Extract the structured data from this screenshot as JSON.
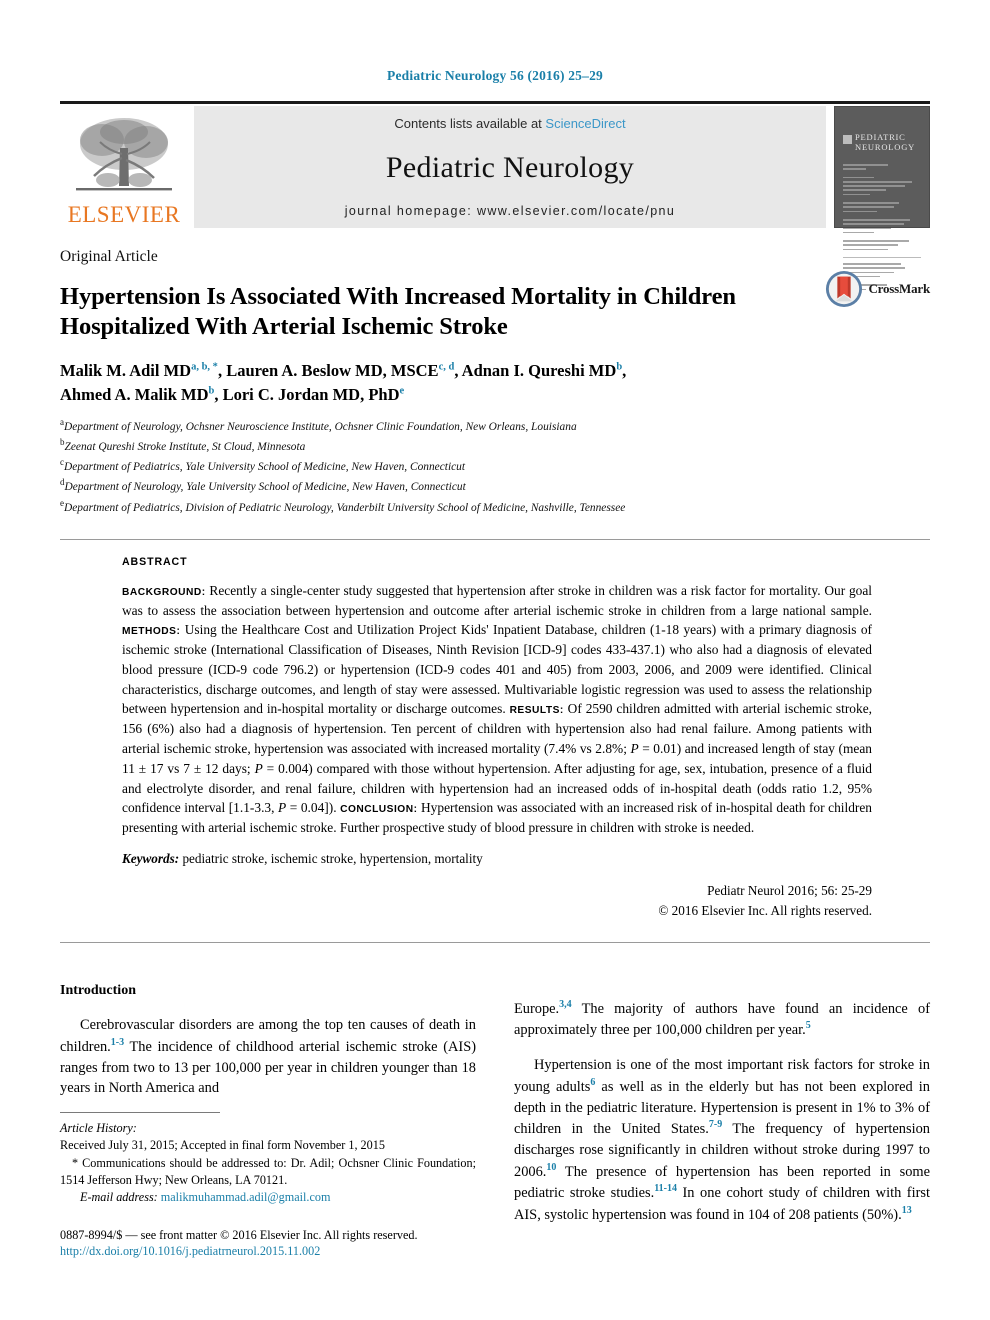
{
  "running_head": "Pediatric Neurology 56 (2016) 25–29",
  "banner": {
    "contents_prefix": "Contents lists available at ",
    "sciencedirect": "ScienceDirect",
    "journal_name": "Pediatric Neurology",
    "homepage": "journal homepage: www.elsevier.com/locate/pnu",
    "publisher": "ELSEVIER",
    "cover_title_line1": "PEDIATRIC",
    "cover_title_line2": "NEUROLOGY"
  },
  "article": {
    "kicker": "Original Article",
    "title_line1": "Hypertension Is Associated With Increased Mortality in Children",
    "title_line2": "Hospitalized With Arterial Ischemic Stroke",
    "crossmark_label": "CrossMark",
    "authors_line1": "Malik M. Adil MD",
    "authors_line1_sup": "a, b, *",
    "authors_line1b": ", Lauren A. Beslow MD, MSCE",
    "authors_line1b_sup": "c, d",
    "authors_line1c": ", Adnan I. Qureshi MD",
    "authors_line1c_sup": "b",
    "authors_line1d": ",",
    "authors_line2": "Ahmed A. Malik MD",
    "authors_line2_sup": "b",
    "authors_line2b": ", Lori C. Jordan MD, PhD",
    "authors_line2b_sup": "e",
    "affiliations": [
      {
        "mark": "a",
        "text": "Department of Neurology, Ochsner Neuroscience Institute, Ochsner Clinic Foundation, New Orleans, Louisiana"
      },
      {
        "mark": "b",
        "text": "Zeenat Qureshi Stroke Institute, St Cloud, Minnesota"
      },
      {
        "mark": "c",
        "text": "Department of Pediatrics, Yale University School of Medicine, New Haven, Connecticut"
      },
      {
        "mark": "d",
        "text": "Department of Neurology, Yale University School of Medicine, New Haven, Connecticut"
      },
      {
        "mark": "e",
        "text": "Department of Pediatrics, Division of Pediatric Neurology, Vanderbilt University School of Medicine, Nashville, Tennessee"
      }
    ]
  },
  "abstract": {
    "label": "ABSTRACT",
    "background_label": "BACKGROUND:",
    "background_text": " Recently a single-center study suggested that hypertension after stroke in children was a risk factor for mortality. Our goal was to assess the association between hypertension and outcome after arterial ischemic stroke in children from a large national sample. ",
    "methods_label": "METHODS:",
    "methods_text": " Using the Healthcare Cost and Utilization Project Kids' Inpatient Database, children (1-18 years) with a primary diagnosis of ischemic stroke (International Classification of Diseases, Ninth Revision [ICD-9] codes 433-437.1) who also had a diagnosis of elevated blood pressure (ICD-9 code 796.2) or hypertension (ICD-9 codes 401 and 405) from 2003, 2006, and 2009 were identified. Clinical characteristics, discharge outcomes, and length of stay were assessed. Multivariable logistic regression was used to assess the relationship between hypertension and in-hospital mortality or discharge outcomes. ",
    "results_label": "RESULTS:",
    "results_text_a": " Of 2590 children admitted with arterial ischemic stroke, 156 (6%) also had a diagnosis of hypertension. Ten percent of children with hypertension also had renal failure. Among patients with arterial ischemic stroke, hypertension was associated with increased mortality (7.4% vs 2.8%; ",
    "results_p1": "P",
    "results_text_b": " = 0.01) and increased length of stay (mean 11 ± 17 vs 7 ± 12 days; ",
    "results_p2": "P",
    "results_text_c": " = 0.004) compared with those without hypertension. After adjusting for age, sex, intubation, presence of a fluid and electrolyte disorder, and renal failure, children with hypertension had an increased odds of in-hospital death (odds ratio 1.2, 95% confidence interval [1.1-3.3, ",
    "results_p3": "P",
    "results_text_d": " = 0.04]). ",
    "conclusion_label": "CONCLUSION:",
    "conclusion_text": " Hypertension was associated with an increased risk of in-hospital death for children presenting with arterial ischemic stroke. Further prospective study of blood pressure in children with stroke is needed.",
    "keywords_label": "Keywords:",
    "keywords_text": " pediatric stroke, ischemic stroke, hypertension, mortality",
    "citation": "Pediatr Neurol 2016; 56: 25-29",
    "copyright": "© 2016 Elsevier Inc. All rights reserved."
  },
  "body": {
    "intro_heading": "Introduction",
    "left_para1_a": "Cerebrovascular disorders are among the top ten causes of death in children.",
    "left_para1_ref1": "1-3",
    "left_para1_b": " The incidence of childhood arterial ischemic stroke (AIS) ranges from two to 13 per 100,000 per year in children younger than 18 years in North America and",
    "right_para1_a": "Europe.",
    "right_para1_ref1": "3,4",
    "right_para1_b": " The majority of authors have found an incidence of approximately three per 100,000 children per year.",
    "right_para1_ref2": "5",
    "right_para2_a": "Hypertension is one of the most important risk factors for stroke in young adults",
    "right_para2_ref1": "6",
    "right_para2_b": " as well as in the elderly but has not been explored in depth in the pediatric literature. Hypertension is present in 1% to 3% of children in the United States.",
    "right_para2_ref2": "7-9",
    "right_para2_c": " The frequency of hypertension discharges rose significantly in children without stroke during 1997 to 2006.",
    "right_para2_ref3": "10",
    "right_para2_d": " The presence of hypertension has been reported in some pediatric stroke studies.",
    "right_para2_ref4": "11-14",
    "right_para2_e": " In one cohort study of children with first AIS, systolic hypertension was found in 104 of 208 patients (50%).",
    "right_para2_ref5": "13"
  },
  "footnote": {
    "history_label": "Article History:",
    "history_text": "Received July 31, 2015; Accepted in final form November 1, 2015",
    "correspondence": "* Communications should be addressed to: Dr. Adil; Ochsner Clinic Foundation; 1514 Jefferson Hwy; New Orleans, LA 70121.",
    "email_label": "E-mail address:",
    "email": "malikmuhammad.adil@gmail.com",
    "issn": "0887-8994/$ — see front matter © 2016 Elsevier Inc. All rights reserved.",
    "doi": "http://dx.doi.org/10.1016/j.pediatrneurol.2015.11.002"
  }
}
